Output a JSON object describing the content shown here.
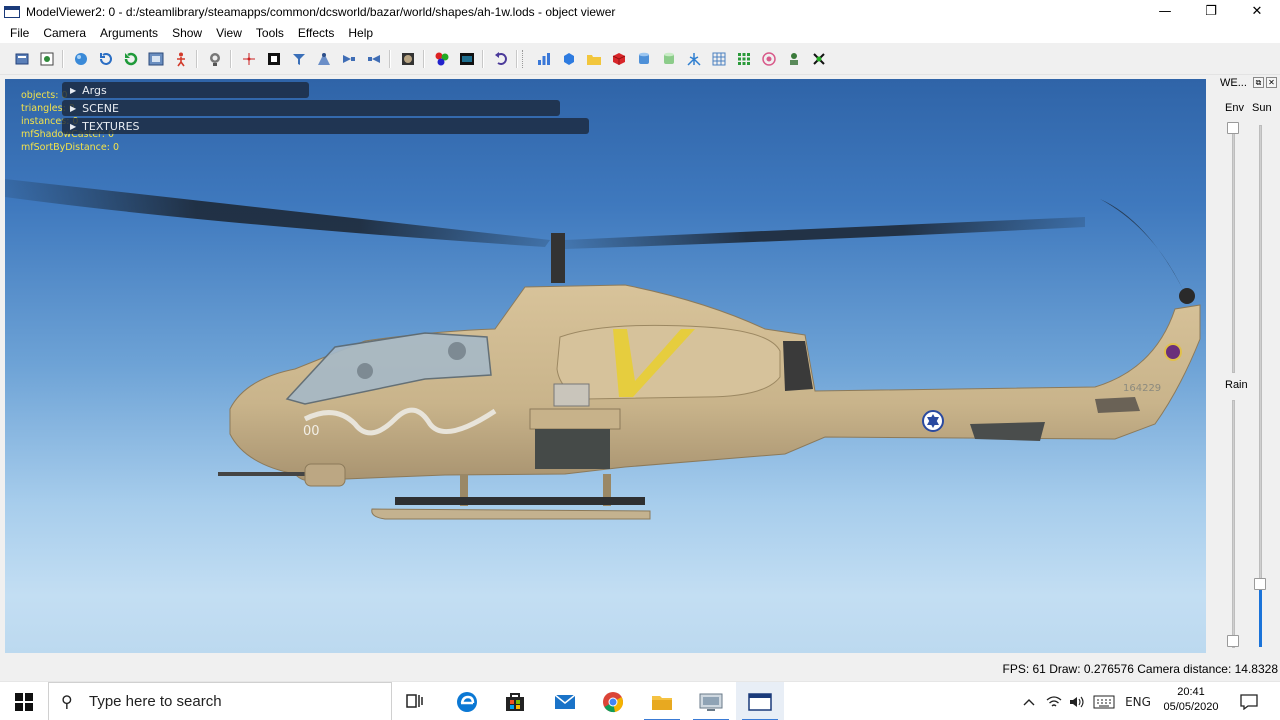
{
  "window": {
    "title": "ModelViewer2: 0 - d:/steamlibrary/steamapps/common/dcsworld/bazar/world/shapes/ah-1w.lods - object viewer",
    "minimize_glyph": "—",
    "maximize_glyph": "❐",
    "close_glyph": "✕"
  },
  "menu": {
    "items": [
      {
        "label": "File"
      },
      {
        "label": "Camera"
      },
      {
        "label": "Arguments"
      },
      {
        "label": "Show"
      },
      {
        "label": "View"
      },
      {
        "label": "Tools"
      },
      {
        "label": "Effects"
      },
      {
        "label": "Help"
      }
    ]
  },
  "overlay": {
    "stats": [
      "objects: 0",
      "triangles: 0",
      "instances: 0",
      "mfShadowCaster: 0",
      "mfSortByDistance: 0"
    ],
    "panels": [
      {
        "label": "Args",
        "arrow": "▶"
      },
      {
        "label": "SCENE",
        "arrow": "▶"
      },
      {
        "label": "TEXTURES",
        "arrow": "▶"
      }
    ]
  },
  "model": {
    "name": "AH-1W",
    "tail_number": "164229",
    "nose_code": "00",
    "colors": {
      "fuselage": "#cdb790",
      "fuselage_dark": "#a8926c",
      "stripe": "#e8cf3e",
      "roundel_blue": "#2a4aa0",
      "glass": "#9fb3c3"
    }
  },
  "right_panel": {
    "title": "WE...",
    "float_glyph": "⧉",
    "close_glyph": "✕",
    "env_label": "Env",
    "sun_label": "Sun",
    "rain_label": "Rain",
    "env_level": 0.0,
    "sun_level": 0.12,
    "rain_level": 0.0,
    "accent": "#1a73d9"
  },
  "status": {
    "text": "FPS: 61  Draw: 0.276576  Camera distance: 14.8328"
  },
  "taskbar": {
    "search_placeholder": "Type here to search",
    "language": "ENG",
    "time": "20:41",
    "date": "05/05/2020",
    "apps": [
      "task-view",
      "edge",
      "store",
      "mail",
      "chrome",
      "file-explorer",
      "remote-desktop",
      "dcs-model-viewer"
    ]
  }
}
